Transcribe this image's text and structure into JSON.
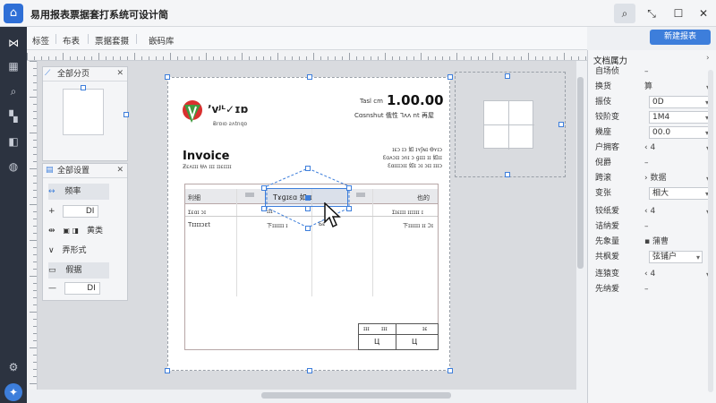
{
  "app": {
    "title": "易用报表票据套打系统可设计简",
    "logo_glyph": "⌂",
    "window_buttons": [
      "⌕",
      "⤡",
      "☐",
      "✕"
    ]
  },
  "toolbar": {
    "menu": [
      "标签",
      "布表",
      "票据套摄",
      "嵌码库"
    ],
    "primary_button": "新建报表"
  },
  "left_rail": {
    "icons": [
      "layout-icon",
      "chart-icon",
      "search-icon",
      "database-icon",
      "layers-icon",
      "chat-icon",
      "settings-icon",
      "help-icon"
    ]
  },
  "float_panel_1": {
    "title": "全部分页",
    "close": "✕"
  },
  "float_panel_2": {
    "title": "全部设置",
    "close": "✕",
    "rows": [
      {
        "icon": "↔",
        "label": "频率",
        "active": true
      },
      {
        "icon": "+",
        "label": "",
        "value": "DI"
      },
      {
        "icon": "⇹",
        "label": "黄类"
      },
      {
        "icon": "∨",
        "label": "弄形式"
      },
      {
        "icon": "▭",
        "label": "假据"
      },
      {
        "icon": "—",
        "label": "",
        "value": "DI"
      }
    ]
  },
  "invoice": {
    "logo_text": "ʼvᴶᴸ✓ɪɒ",
    "logo_sub": "Ƀrɒıɒ ƨʌtnqɒ",
    "total_label": "Tasl cm",
    "total_value": "1.00.00",
    "header_line": "Cɑsnshut 俄性 Ꞁʌʌ nt 再屋",
    "addr_lines": [
      "ɪɛɔ ɪɔ 如 ɪʏʃɴɪ Ɵʏɪɔ",
      "Ɛɑʌɔɪɪ ɔnɪ ɔ ɡɪɪɪ ɪɪ 如ɪɪ",
      "Ɛɑɪɪɪɔɪɪ 如ɪ ɔɪ ɔɪɪ ɪɪɪɔ"
    ],
    "doc_title": "Invoice",
    "doc_sub": "Ƶɛʌɪɪɪ Ʉʌ ɪɪɪ ɪɪɛɪɪɪɪ",
    "table_header": [
      "利细",
      "",
      "Tɤɡɪɛɑ 如ɪɪ",
      "",
      "也的"
    ],
    "selected_cell_text": "Tɤɡɪɛɑ 如ɪɪ",
    "row1": [
      "Ɪɛɑɪ ɔɪ",
      "ɪɪɪ",
      "",
      "Ɪɪɛɪɪɪ ɪɪɪɪɪɪ ɪ"
    ],
    "row2": [
      "Tɪɪɪɪɔɛt",
      "下ɪɪɪɪɪɪ ɪ",
      "Ƃɛ",
      "下ɪɪɪɪɪɪ ɪɪ Ɔɪ"
    ],
    "totals_header": [
      "ɪɪɪ",
      "ɪɪɪ",
      "ɪɛ"
    ],
    "totals_values": [
      "Ц",
      "Ц"
    ]
  },
  "properties": {
    "title": "文档属力",
    "rows": [
      {
        "label": "自场侦",
        "value": "–",
        "type": "text"
      },
      {
        "label": "换货",
        "value": "算",
        "type": "dropdown-flat"
      },
      {
        "label": "振伎",
        "value": "0D",
        "type": "input"
      },
      {
        "label": "铰阶变",
        "value": "1M4",
        "type": "input"
      },
      {
        "label": "幾座",
        "value": "00.0",
        "type": "input"
      },
      {
        "label": "户拥客",
        "value": "‹ 4",
        "type": "dropdown-flat"
      },
      {
        "label": "倪爵",
        "value": "–",
        "type": "text"
      },
      {
        "label": "跨滚",
        "value": "› 数据",
        "type": "dropdown-flat"
      },
      {
        "label": "变张",
        "value": "相大",
        "type": "input"
      },
      {
        "label": "铰纸爱",
        "value": "‹ 4",
        "type": "dropdown-flat"
      },
      {
        "label": "诘纳爱",
        "value": "–",
        "type": "text"
      },
      {
        "label": "先象量",
        "value": "▪ 蒲曹",
        "type": "text"
      },
      {
        "label": "共枫爱",
        "value": "弦铺户",
        "type": "input-small"
      },
      {
        "label": "连猿变",
        "value": "‹ 4",
        "type": "dropdown-flat"
      },
      {
        "label": "先纳爱",
        "value": "–",
        "type": "text"
      }
    ]
  },
  "colors": {
    "accent": "#3d7edb",
    "rail": "#2c3340",
    "logo_red": "#d9302f",
    "logo_green": "#3f9b3f"
  }
}
